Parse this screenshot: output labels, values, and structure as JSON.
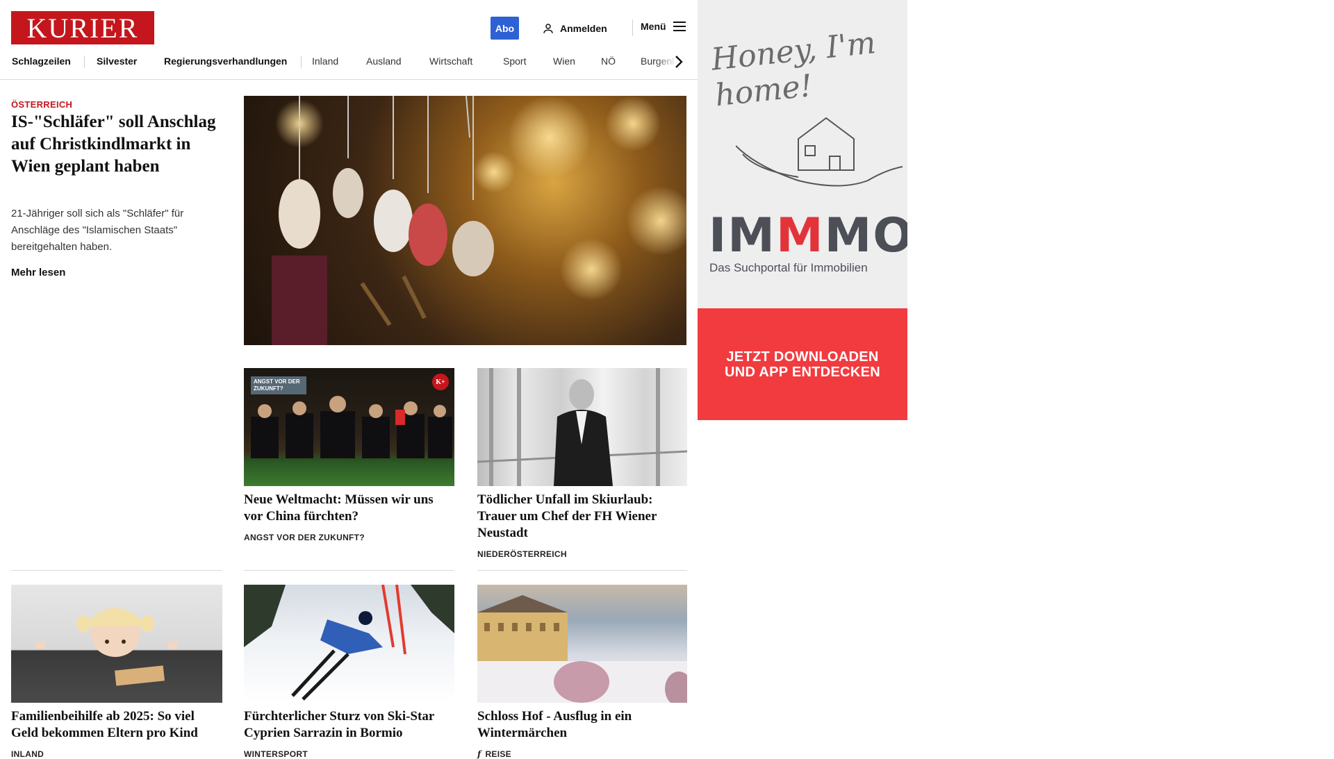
{
  "header": {
    "logo": "KURIER",
    "abo": "Abo",
    "login": "Anmelden",
    "menu": "Menü"
  },
  "nav": {
    "items": [
      "Schlagzeilen",
      "Silvester",
      "Regierungsverhandlungen",
      "Inland",
      "Ausland",
      "Wirtschaft",
      "Sport",
      "Wien",
      "NÖ",
      "Burgenl"
    ]
  },
  "lead": {
    "kicker": "ÖSTERREICH",
    "title": "IS-\"Schläfer\" soll An­schlag auf Christkindl­markt in Wien geplant haben",
    "teaser": "21-Jähriger soll sich als \"Schläfer\" für Anschläge des \"Islamischen Staats\" bereitgehalten haben.",
    "more": "Mehr lesen"
  },
  "cards": [
    {
      "title": "Neue Weltmacht: Müssen wir uns vor China fürchten?",
      "kicker": "ANGST VOR DER ZUKUNFT?",
      "overlay": "ANGST VOR DER ZUKUNFT?",
      "premium_badge": "K+"
    },
    {
      "title": "Tödlicher Unfall im Skiurlaub: Trauer um Chef der FH Wiener Neustadt",
      "kicker": "NIEDERÖSTERREICH"
    },
    {
      "title": "Familienbeihilfe ab 2025: So viel Geld bekommen Eltern pro Kind",
      "kicker": "INLAND"
    },
    {
      "title": "Fürchterlicher Sturz von Ski-Star Cyprien Sarrazin in Bormio",
      "kicker": "WINTERSPORT"
    },
    {
      "title": "Schloss Hof - Ausflug in ein Wintermärchen",
      "kicker": "REISE",
      "kicker_icon": "f"
    }
  ],
  "ad": {
    "script": "Honey, I'm home!",
    "brand_prefix": "IM",
    "brand_highlight": "M",
    "brand_suffix": "MO",
    "tagline": "Das Suchportal für Immobilien",
    "cta_line1": "JETZT DOWNLOADEN",
    "cta_line2": "UND APP ENTDECKEN"
  },
  "colors": {
    "brand_red": "#c4161c",
    "abo_blue": "#2e61d4",
    "ad_red": "#f13b3f"
  }
}
